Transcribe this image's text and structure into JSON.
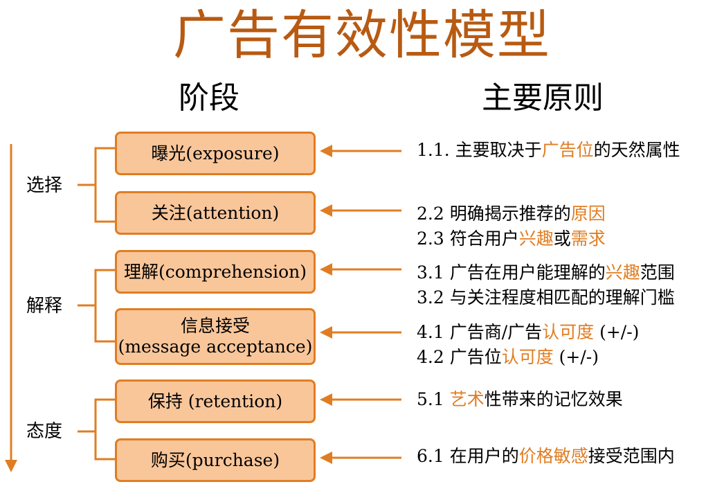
{
  "title": "广告有效性模型",
  "headers": {
    "stages": "阶段",
    "principles": "主要原则"
  },
  "groups": [
    {
      "label": "选择"
    },
    {
      "label": "解释"
    },
    {
      "label": "态度"
    }
  ],
  "stages": [
    {
      "label": "曝光(exposure)"
    },
    {
      "label": "关注(attention)"
    },
    {
      "label": "理解(comprehension)"
    },
    {
      "line1": "信息接受",
      "line2": "(message acceptance)"
    },
    {
      "label": "保持 (retention)"
    },
    {
      "label": "购买(purchase)"
    }
  ],
  "principles": [
    {
      "parts": [
        {
          "t": "1.1. 主要取决于"
        },
        {
          "t": "广告位",
          "hl": true
        },
        {
          "t": "的天然属性"
        }
      ]
    },
    {
      "parts": [
        {
          "t": "2.2 明确揭示推荐的"
        },
        {
          "t": "原因",
          "hl": true
        }
      ]
    },
    {
      "parts": [
        {
          "t": "2.3 符合用户"
        },
        {
          "t": "兴趣",
          "hl": true
        },
        {
          "t": "或"
        },
        {
          "t": "需求",
          "hl": true
        }
      ]
    },
    {
      "parts": [
        {
          "t": "3.1 广告在用户能理解的"
        },
        {
          "t": "兴趣",
          "hl": true
        },
        {
          "t": "范围"
        }
      ]
    },
    {
      "parts": [
        {
          "t": "3.2 与关注程度相匹配的理解门槛"
        }
      ]
    },
    {
      "parts": [
        {
          "t": "4.1 广告商/广告"
        },
        {
          "t": "认可度",
          "hl": true
        },
        {
          "t": " (+/-)"
        }
      ]
    },
    {
      "parts": [
        {
          "t": "4.2 广告位"
        },
        {
          "t": "认可度",
          "hl": true
        },
        {
          "t": " (+/-)"
        }
      ]
    },
    {
      "parts": [
        {
          "t": "5.1 "
        },
        {
          "t": "艺术",
          "hl": true
        },
        {
          "t": "性带来的记忆效果"
        }
      ]
    },
    {
      "parts": [
        {
          "t": "6.1 在用户的"
        },
        {
          "t": "价格敏感",
          "hl": true
        },
        {
          "t": "接受范围内"
        }
      ]
    }
  ],
  "colors": {
    "accent": "#e07d22",
    "box_fill": "#f9c69a",
    "title": "#b85a12"
  }
}
